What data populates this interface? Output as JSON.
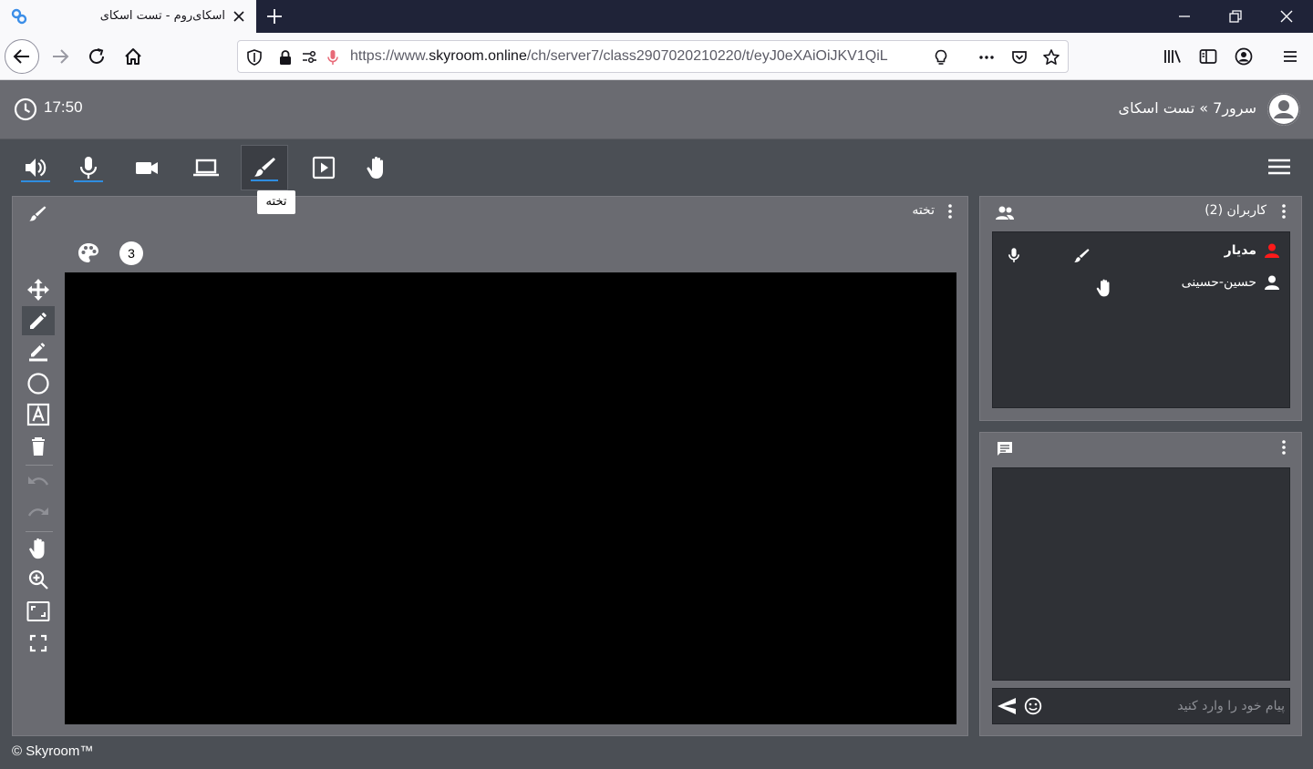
{
  "browser": {
    "tab_title": "اسکای‌روم - تست اسکای",
    "url_prefix": "https://www.",
    "url_host": "skyroom.online",
    "url_path": "/ch/server7/class2907020210220/t/eyJ0eXAiOiJKV1QiL"
  },
  "header": {
    "time": "17:50",
    "breadcrumb": "سرور7 » تست اسکای"
  },
  "toolbar": {
    "tooltip": "تخته",
    "accent": "#2f8de0"
  },
  "board": {
    "title": "تخته",
    "page_number": "3"
  },
  "users": {
    "title": "کاربران (2)",
    "list": [
      {
        "name": "مدیار",
        "role_color": "#ff1a1a"
      },
      {
        "name": "حسین-حسینی",
        "role_color": "#ffffff"
      }
    ]
  },
  "chat": {
    "placeholder": "پیام خود را وارد کنید"
  },
  "footer": {
    "text": "© Skyroom™"
  }
}
